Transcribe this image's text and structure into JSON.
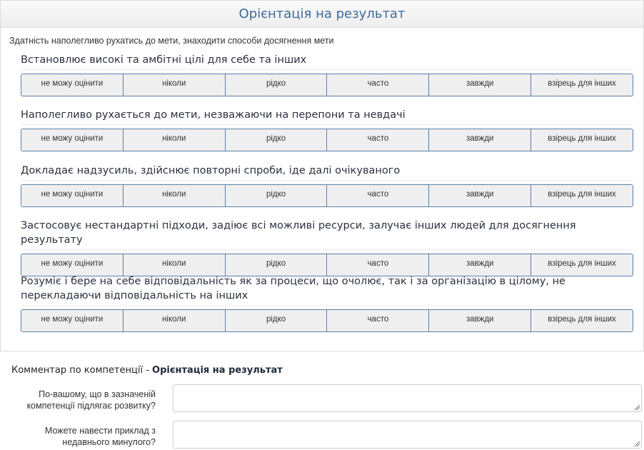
{
  "panel": {
    "title": "Орієнтація на результат",
    "description": "Здатність наполегливо рухатись до мети, знаходити способи досягнення мети"
  },
  "rating_options": [
    "не можу оцінити",
    "ніколи",
    "рідко",
    "часто",
    "завжди",
    "взірець для інших"
  ],
  "questions": [
    {
      "text": "Встановлює високі та амбітні цілі для себе та інших"
    },
    {
      "text": "Наполегливо рухається до мети, незважаючи на перепони та невдачі"
    },
    {
      "text": "Докладає надзусиль, здійснює повторні спроби, іде далі очікуваного"
    },
    {
      "text": "Застосовує нестандартні підходи, задіює всі можливі ресурси, залучає інших людей для досягнення результату"
    },
    {
      "text": "Розуміє і бере на себе відповідальність як за процеси, що очолює, так і за організацію в цілому, не перекладаючи відповідальність на інших"
    }
  ],
  "comment": {
    "prefix": "Комментар по компетенції - ",
    "competency": "Орієнтація на результат",
    "fields": [
      {
        "label": "По-вашому, що в зазначеній компетенції підлягає розвитку?",
        "value": ""
      },
      {
        "label": "Можете навести приклад з недавнього минулого?",
        "value": ""
      }
    ]
  }
}
